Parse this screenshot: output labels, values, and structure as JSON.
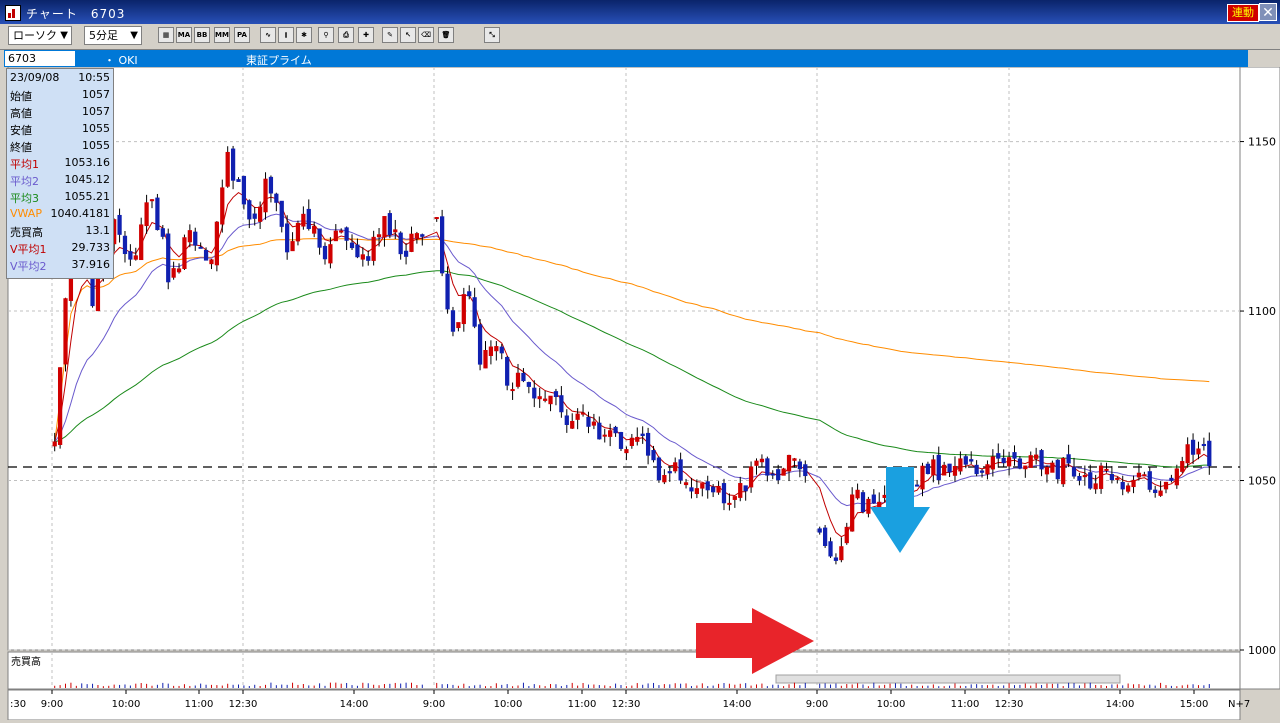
{
  "window": {
    "title": "チャート　6703",
    "link_label": "連動",
    "close_glyph": "✕"
  },
  "toolbar": {
    "chart_type": "ローソク",
    "interval": "5分足",
    "icons": [
      {
        "name": "chart-settings-icon",
        "glyph": "▦"
      },
      {
        "name": "ma-icon",
        "glyph": "MA"
      },
      {
        "name": "bb-icon",
        "glyph": "BB"
      },
      {
        "name": "mme-icon",
        "glyph": "MME"
      },
      {
        "name": "pa-icon",
        "glyph": "PA"
      },
      {
        "name": "line-chart-icon",
        "glyph": "∿"
      },
      {
        "name": "candle-chart-icon",
        "glyph": "⫾"
      },
      {
        "name": "cross-icon",
        "glyph": "✱"
      },
      {
        "name": "zoom-icon",
        "glyph": "⚲"
      },
      {
        "name": "print-icon",
        "glyph": "⎙"
      },
      {
        "name": "crosshair-icon",
        "glyph": "✚"
      },
      {
        "name": "pen-icon",
        "glyph": "✎"
      },
      {
        "name": "pointer-icon",
        "glyph": "↖"
      },
      {
        "name": "eraser-icon",
        "glyph": "⌫"
      },
      {
        "name": "trash-icon",
        "glyph": "🗑"
      },
      {
        "name": "auto-draw-icon",
        "glyph": "⤡"
      }
    ]
  },
  "symbol": {
    "code": "6703",
    "name": "・ OKI",
    "market": "東証プライム"
  },
  "info": [
    {
      "label": "23/09/08",
      "value": "10:55",
      "color": "#000000"
    },
    {
      "label": "始値",
      "value": "1057",
      "color": "#000000"
    },
    {
      "label": "高値",
      "value": "1057",
      "color": "#000000"
    },
    {
      "label": "安値",
      "value": "1055",
      "color": "#000000"
    },
    {
      "label": "終値",
      "value": "1055",
      "color": "#000000"
    },
    {
      "label": "平均1",
      "value": "1053.16",
      "color": "#c00000"
    },
    {
      "label": "平均2",
      "value": "1045.12",
      "color": "#6a5acd"
    },
    {
      "label": "平均3",
      "value": "1055.21",
      "color": "#1a8a1a"
    },
    {
      "label": "VWAP",
      "value": "1040.4181",
      "color": "#ff8c00"
    },
    {
      "label": "売買高",
      "value": "13.1",
      "color": "#000000"
    },
    {
      "label": "V平均1",
      "value": "29.733",
      "color": "#c00000"
    },
    {
      "label": "V平均2",
      "value": "37.916",
      "color": "#6a5acd"
    }
  ],
  "chart_data": {
    "type": "candlestick",
    "y_ticks": [
      1150,
      1100,
      1050,
      1000
    ],
    "ylim": [
      1000,
      1172
    ],
    "x_ticks": [
      "9:00",
      "10:00",
      "11:00",
      "12:30",
      "14:00",
      "9:00",
      "10:00",
      "11:00",
      "12:30",
      "14:00",
      "9:00",
      "10:00",
      "11:00",
      "12:30",
      "14:00",
      "15:00"
    ],
    "x_left_label": ":30",
    "x_right_label": "N+7",
    "volume_label": "売買高",
    "reference_price": 1054,
    "colors": {
      "up": "#d00000",
      "down": "#1020b0",
      "ma1": "#c00000",
      "ma2": "#6a5acd",
      "ma3": "#1a8a1a",
      "vwap": "#ff8c00"
    },
    "days": [
      {
        "open": 1060,
        "path": [
          1060,
          1135,
          1100,
          1128,
          1112,
          1135,
          1108,
          1125,
          1112,
          1146,
          1125,
          1138,
          1120,
          1127,
          1118,
          1124,
          1115,
          1127,
          1118,
          1125
        ]
      },
      {
        "open": 1127,
        "path": [
          1127,
          1092,
          1106,
          1086,
          1090,
          1078,
          1082,
          1072,
          1076,
          1064,
          1070,
          1062,
          1064,
          1060,
          1062,
          1052,
          1056,
          1047,
          1052,
          1046,
          1044,
          1050,
          1056,
          1052,
          1058,
          1052
        ]
      },
      {
        "open": 1035,
        "path": [
          1035,
          1028,
          1046,
          1040,
          1050,
          1046,
          1054,
          1052,
          1056,
          1052,
          1059,
          1054,
          1056,
          1052,
          1055,
          1049,
          1052,
          1048,
          1050,
          1047,
          1054,
          1060,
          1057
        ]
      }
    ],
    "annotations": [
      {
        "type": "arrow",
        "direction": "down",
        "color": "#1aa0e0",
        "label": ""
      },
      {
        "type": "arrow",
        "direction": "right",
        "color": "#e8242a",
        "label": ""
      }
    ]
  }
}
